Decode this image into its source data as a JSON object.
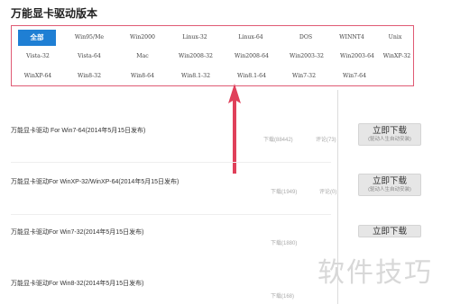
{
  "page_title": "万能显卡驱动版本",
  "versions": {
    "row1": [
      "全部",
      "Win95/Me",
      "Win2000",
      "Linux-32",
      "Linux-64",
      "DOS",
      "WINNT4",
      "Unix"
    ],
    "row2": [
      "Vista-32",
      "Vista-64",
      "Mac",
      "Win2008-32",
      "Win2008-64",
      "Win2003-32",
      "Win2003-64",
      "WinXP-32"
    ],
    "row3": [
      "WinXP-64",
      "Win8-32",
      "Win8-64",
      "Win8.1-32",
      "Win8.1-64",
      "Win7-32",
      "Win7-64"
    ]
  },
  "downloads": [
    {
      "title": "万能显卡驱动 For Win7-64(2014年5月15日发布)",
      "downloads": "下载(88442)",
      "comments": "评论(73)",
      "button": "立即下载",
      "button_sub": "(驱动人生自动安装)"
    },
    {
      "title": "万能显卡驱动For WinXP-32/WinXP-64(2014年5月15日发布)",
      "downloads": "下载(1949)",
      "comments": "评论(0)",
      "button": "立即下载",
      "button_sub": "(驱动人生自动安装)"
    },
    {
      "title": "万能显卡驱动For Win7-32(2014年5月15日发布)",
      "downloads": "下载(1880)",
      "button": "立即下载"
    },
    {
      "title": "万能显卡驱动For Win8-32(2014年5月15日发布)",
      "downloads": "下载(168)"
    }
  ],
  "watermark": "软件技巧",
  "colors": {
    "active_tab": "#1f7fd4",
    "panel_border": "#e05a74",
    "arrow": "#e0405a"
  }
}
